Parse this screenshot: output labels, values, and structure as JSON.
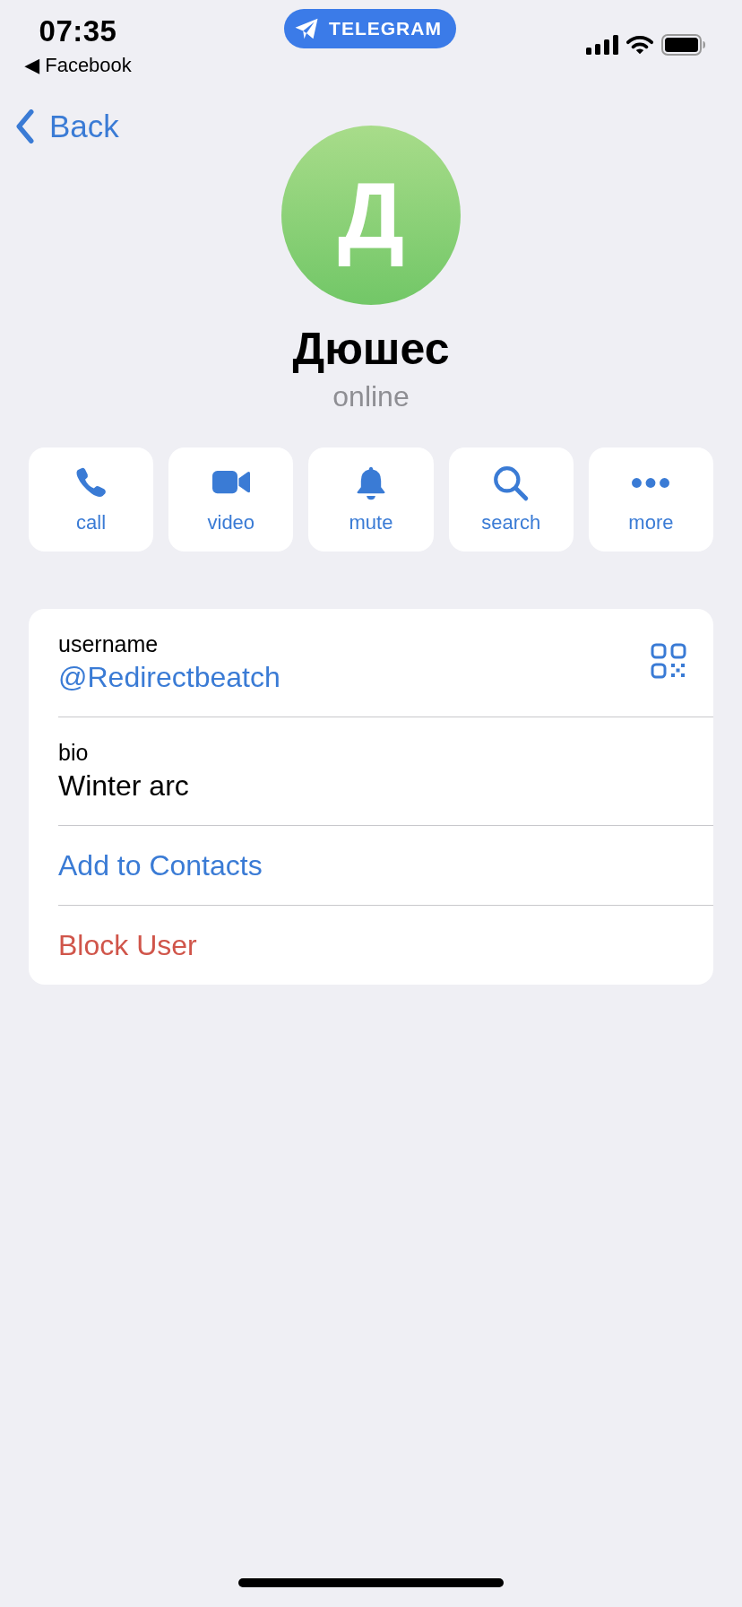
{
  "status_bar": {
    "time": "07:35",
    "back_app": "◀ Facebook",
    "app_pill": "TELEGRAM"
  },
  "nav": {
    "back": "Back"
  },
  "profile": {
    "initial": "Д",
    "name": "Дюшес",
    "status": "online"
  },
  "actions": [
    {
      "kind": "call",
      "label": "call"
    },
    {
      "kind": "video",
      "label": "video"
    },
    {
      "kind": "mute",
      "label": "mute"
    },
    {
      "kind": "search",
      "label": "search"
    },
    {
      "kind": "more",
      "label": "more"
    }
  ],
  "info_rows": [
    {
      "kind": "username",
      "label": "username",
      "value": "@Redirectbeatch"
    },
    {
      "kind": "text",
      "label": "bio",
      "value": "Winter arc"
    },
    {
      "kind": "action",
      "text": "Add to Contacts"
    },
    {
      "kind": "danger",
      "text": "Block User"
    }
  ]
}
